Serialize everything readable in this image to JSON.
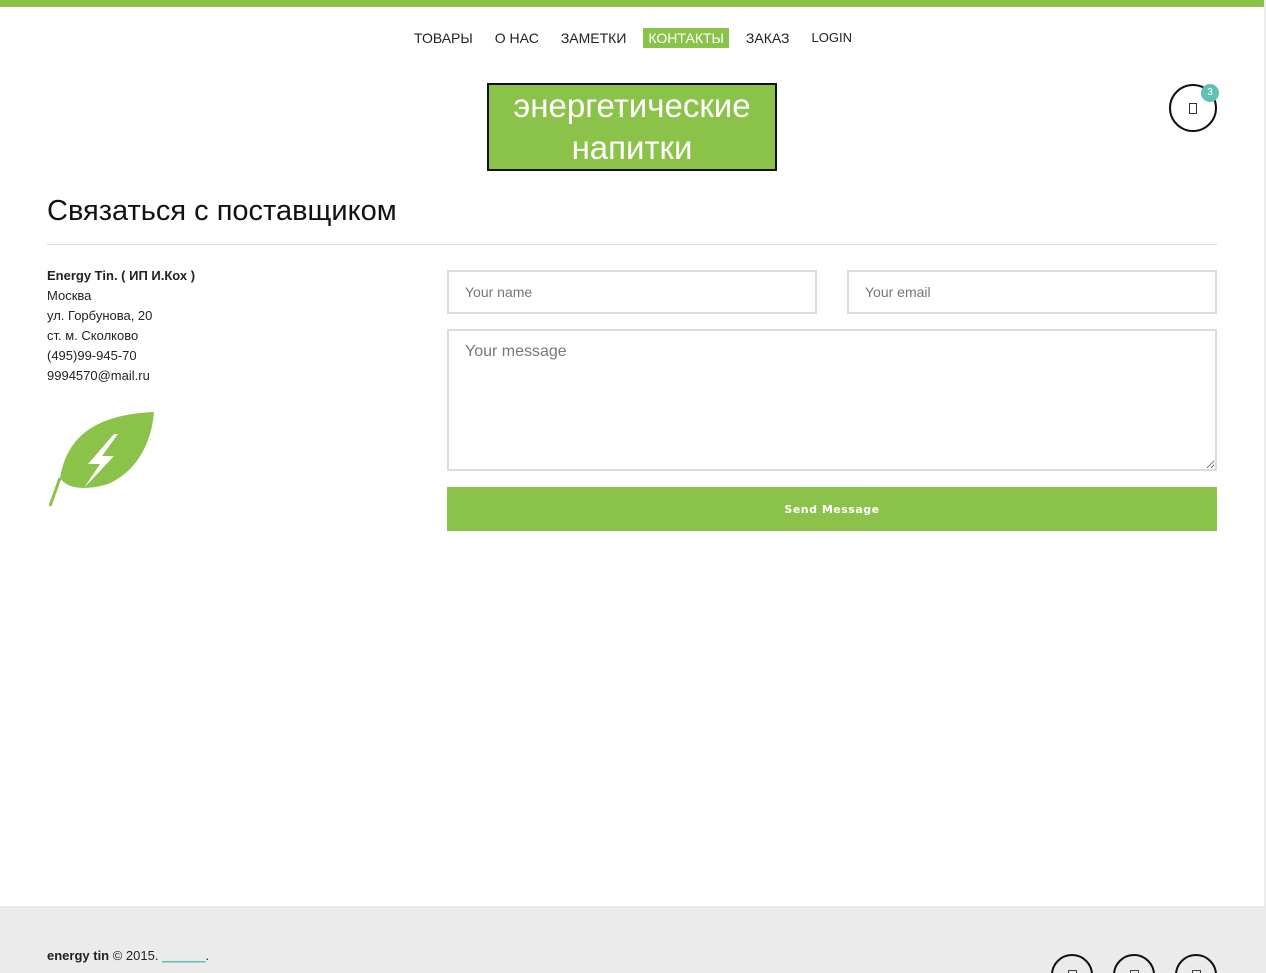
{
  "nav": {
    "items": [
      {
        "label": "ТОВАРЫ"
      },
      {
        "label": "О НАС"
      },
      {
        "label": "ЗАМЕТКИ"
      },
      {
        "label": "КОНТАКТЫ",
        "active": true
      },
      {
        "label": "ЗАКАЗ"
      },
      {
        "label": "LOGIN"
      }
    ]
  },
  "logo": {
    "line1": "энергетические",
    "line2": "напитки"
  },
  "cart": {
    "count": "3",
    "icon": "cart-icon"
  },
  "page": {
    "title": "Связаться с поставщиком"
  },
  "contact": {
    "company": "Energy Tin. ( ИП И.Кох )",
    "city": "Москва",
    "street": "ул. Горбунова, 20",
    "metro": "ст. м. Сколково",
    "phone": "(495)99-945-70",
    "email": "9994570@mail.ru"
  },
  "form": {
    "name_placeholder": "Your name",
    "email_placeholder": "Your email",
    "message_placeholder": "Your message",
    "send_label": "Send Message"
  },
  "footer": {
    "brand": "energy tin",
    "copyright": " © 2015. ",
    "link": "______",
    "period": ".",
    "social_icons": [
      "social-icon",
      "social-icon",
      "social-icon"
    ]
  },
  "colors": {
    "accent": "#8bc34a",
    "badge": "#5fc1b3",
    "footer_bg": "#ebebeb"
  }
}
